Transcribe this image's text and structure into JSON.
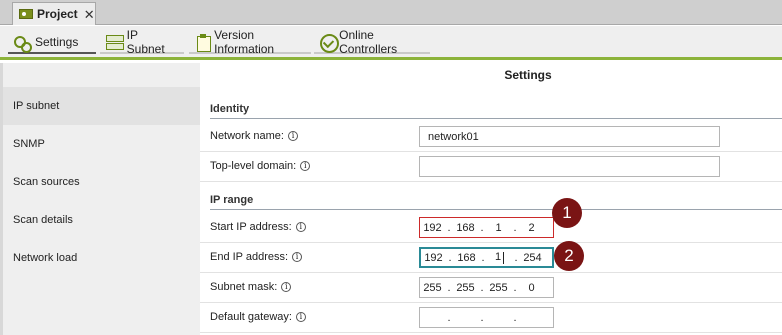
{
  "doc_tab": {
    "label": "Project",
    "close": "✕"
  },
  "toolbar": {
    "tabs": [
      {
        "label": "Settings",
        "icon": "settings-icon"
      },
      {
        "label": "IP Subnet",
        "icon": "subnet-icon"
      },
      {
        "label": "Version Information",
        "icon": "version-icon"
      },
      {
        "label": "Online Controllers",
        "icon": "online-controllers-icon"
      }
    ],
    "active_tab": "Settings"
  },
  "sidebar": {
    "items": [
      {
        "label": "IP subnet"
      },
      {
        "label": "SNMP"
      },
      {
        "label": "Scan sources"
      },
      {
        "label": "Scan details"
      },
      {
        "label": "Network load"
      }
    ],
    "selected": "IP subnet"
  },
  "main": {
    "title": "Settings",
    "identity": {
      "heading": "Identity",
      "network_name_label": "Network name:",
      "network_name_value": "network01",
      "top_level_domain_label": "Top-level domain:",
      "top_level_domain_value": ""
    },
    "ip_range": {
      "heading": "IP range",
      "start_label": "Start IP address:",
      "start_octets": [
        "192",
        "168",
        "1",
        "2"
      ],
      "end_label": "End IP address:",
      "end_octets": [
        "192",
        "168",
        "1",
        "254"
      ],
      "mask_label": "Subnet mask:",
      "mask_octets": [
        "255",
        "255",
        "255",
        "0"
      ],
      "gateway_label": "Default gateway:",
      "gateway_octets": [
        "",
        "",
        "",
        ""
      ]
    },
    "info_glyph": "i",
    "dot": "."
  },
  "annotations": {
    "badge1": "1",
    "badge2": "2"
  },
  "colors": {
    "accent": "#8cb33a",
    "badge": "#7a1414",
    "error_border": "#cc2a2a",
    "focus_border": "#2a8a96"
  }
}
